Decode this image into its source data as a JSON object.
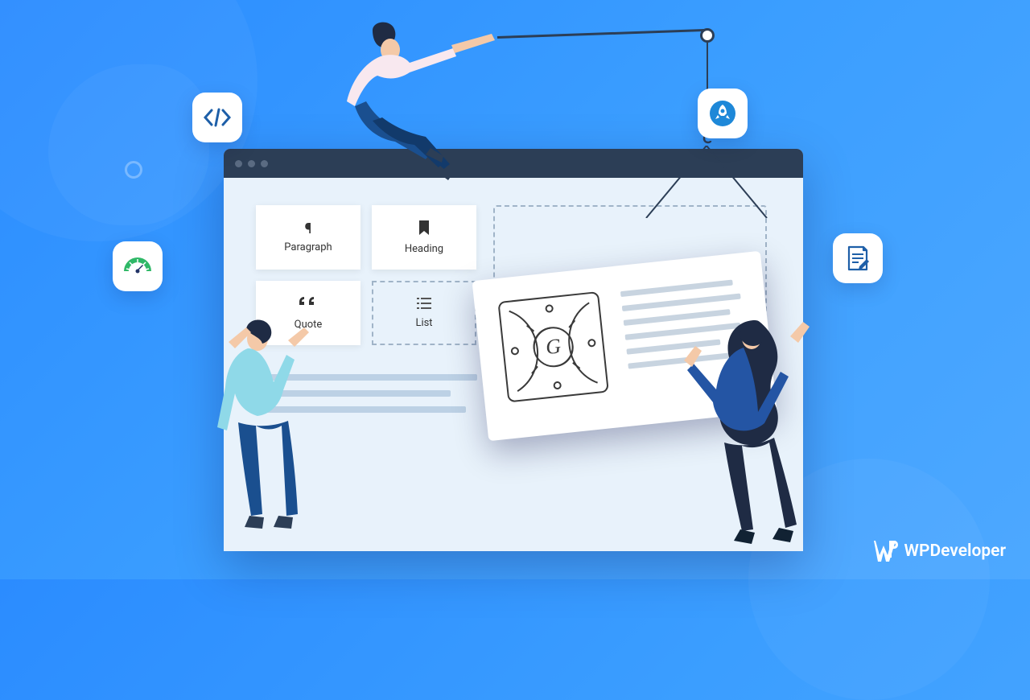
{
  "blocks": {
    "paragraph": {
      "label": "Paragraph",
      "icon": "¶"
    },
    "heading": {
      "label": "Heading"
    },
    "quote": {
      "label": "Quote"
    },
    "list": {
      "label": "List"
    }
  },
  "watermark": {
    "brand": "WPDeveloper"
  },
  "colors": {
    "accent": "#2b8cff",
    "dark": "#2c3e56",
    "green": "#2fb867",
    "iconBlue": "#1e5fa8"
  }
}
